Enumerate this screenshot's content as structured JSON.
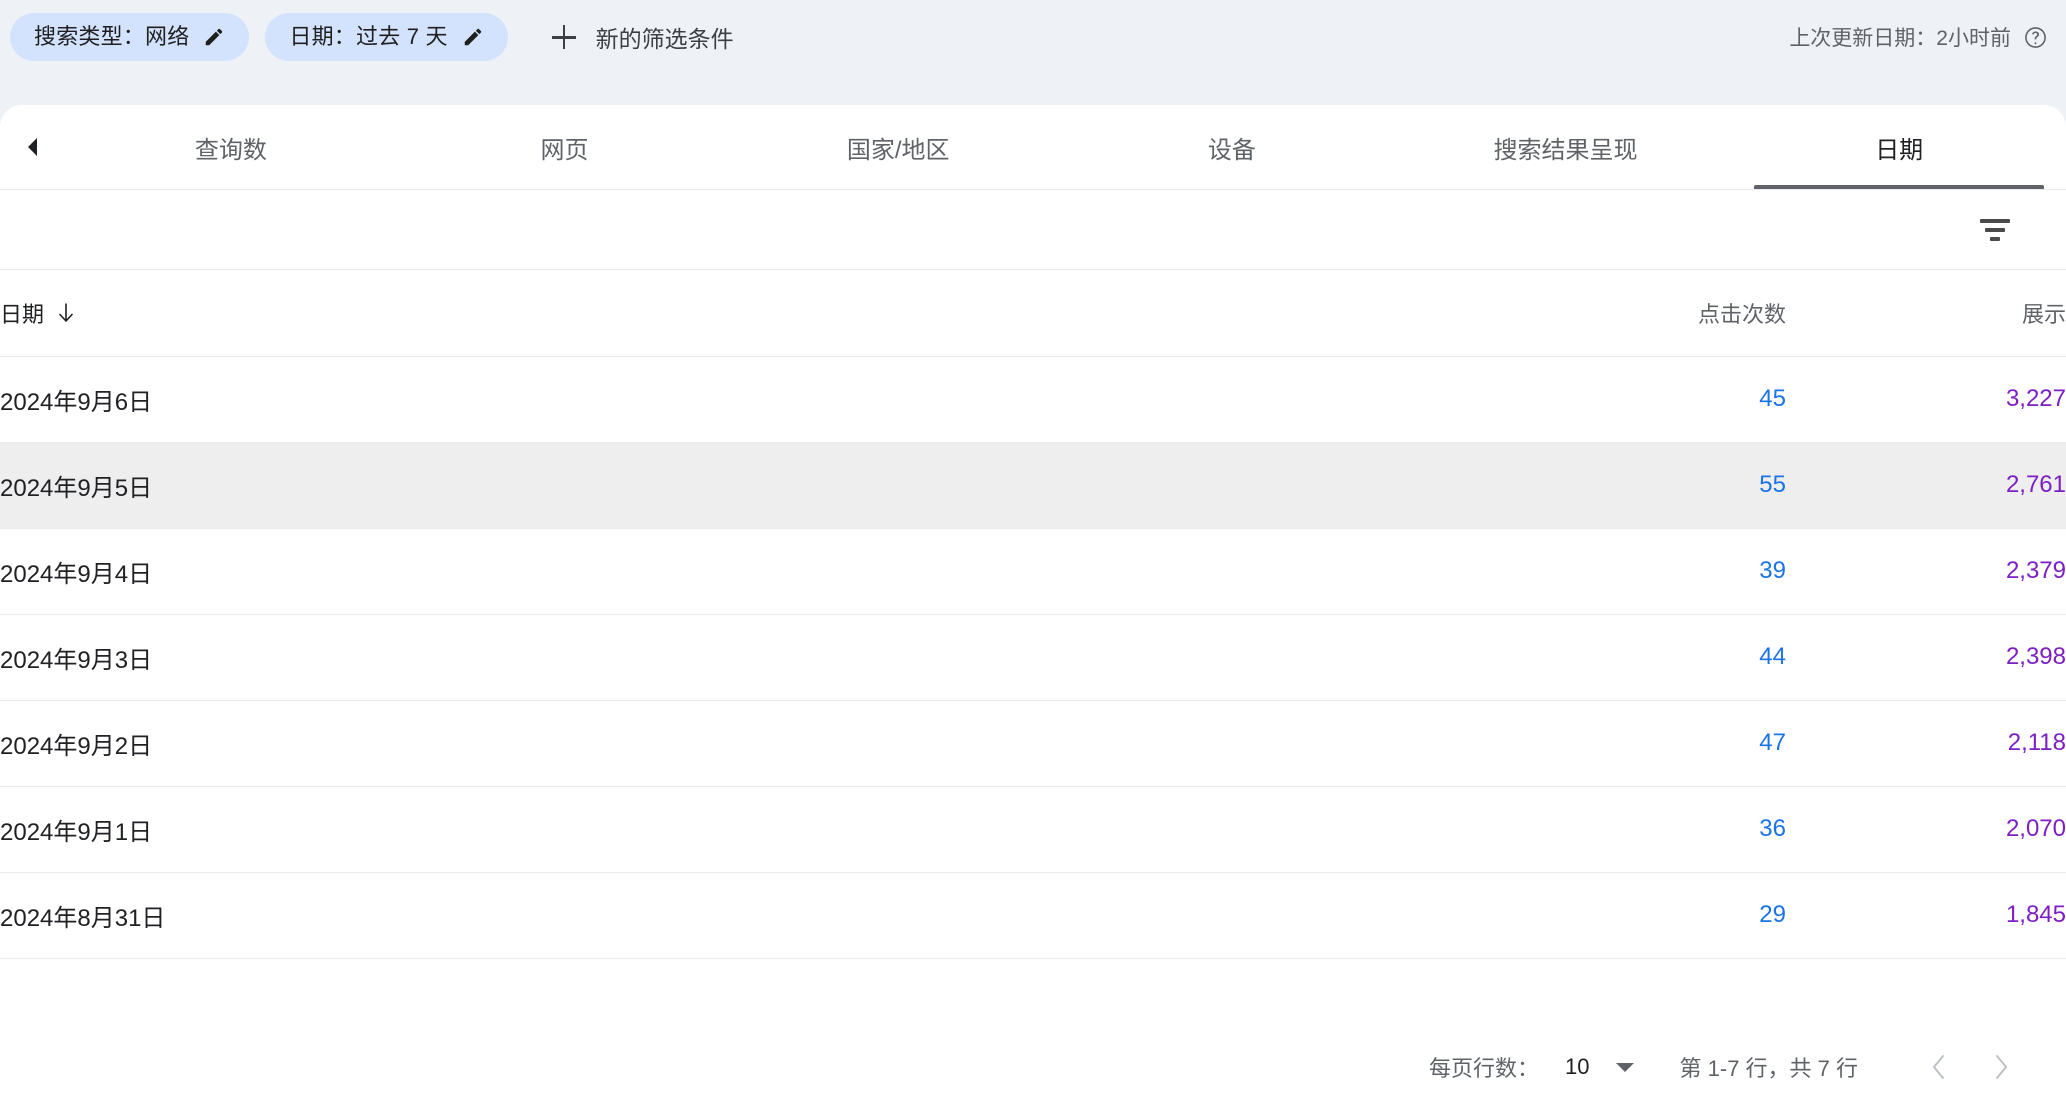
{
  "filter_bar": {
    "chips": [
      {
        "label": "搜索类型：网络",
        "icon": "pencil-icon"
      },
      {
        "label": "日期：过去 7 天",
        "icon": "pencil-icon"
      }
    ],
    "new_filter_label": "新的筛选条件",
    "last_update_label": "上次更新日期：2小时前"
  },
  "tabs": {
    "items": [
      {
        "label": "查询数",
        "active": false
      },
      {
        "label": "网页",
        "active": false
      },
      {
        "label": "国家/地区",
        "active": false
      },
      {
        "label": "设备",
        "active": false
      },
      {
        "label": "搜索结果呈现",
        "active": false
      },
      {
        "label": "日期",
        "active": true
      }
    ]
  },
  "table": {
    "columns": {
      "date": "日期",
      "clicks": "点击次数",
      "impressions": "展示"
    },
    "sort": {
      "column": "日期",
      "direction": "desc"
    },
    "rows": [
      {
        "date": "2024年9月6日",
        "clicks": "45",
        "impressions": "3,227",
        "highlight": false
      },
      {
        "date": "2024年9月5日",
        "clicks": "55",
        "impressions": "2,761",
        "highlight": true
      },
      {
        "date": "2024年9月4日",
        "clicks": "39",
        "impressions": "2,379",
        "highlight": false
      },
      {
        "date": "2024年9月3日",
        "clicks": "44",
        "impressions": "2,398",
        "highlight": false
      },
      {
        "date": "2024年9月2日",
        "clicks": "47",
        "impressions": "2,118",
        "highlight": false
      },
      {
        "date": "2024年9月1日",
        "clicks": "36",
        "impressions": "2,070",
        "highlight": false
      },
      {
        "date": "2024年8月31日",
        "clicks": "29",
        "impressions": "1,845",
        "highlight": false
      }
    ]
  },
  "footer": {
    "rows_per_page_label": "每页行数：",
    "rows_per_page_value": "10",
    "range_label": "第 1-7 行，共 7 行"
  },
  "colors": {
    "page_background": "#eef1f6",
    "chip_background": "#d3e3fd",
    "clicks": "#1a73e8",
    "impressions": "#7d1fc4",
    "row_highlight": "#eeeeee",
    "active_tab_underline": "#5f6368"
  }
}
